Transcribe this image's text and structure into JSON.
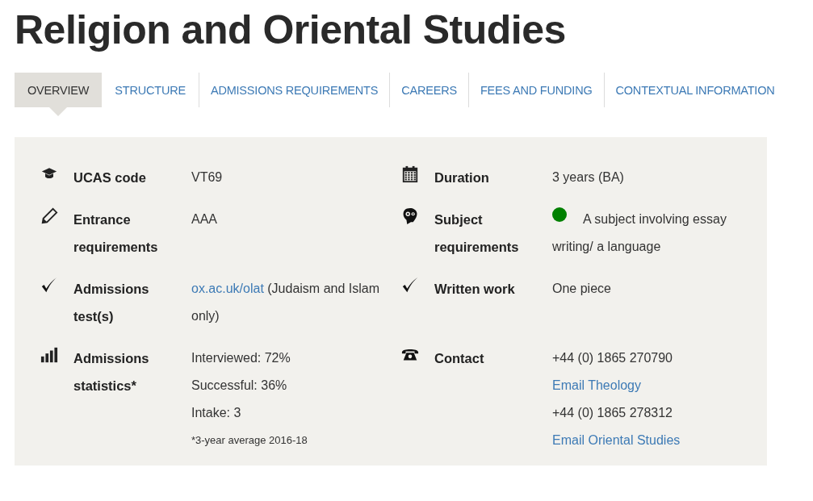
{
  "title": "Religion and Oriental Studies",
  "tabs": [
    {
      "label": "OVERVIEW",
      "selected": true
    },
    {
      "label": "STRUCTURE",
      "selected": false
    },
    {
      "label": "ADMISSIONS REQUIREMENTS",
      "selected": false
    },
    {
      "label": "CAREERS",
      "selected": false
    },
    {
      "label": "FEES AND FUNDING",
      "selected": false
    },
    {
      "label": "CONTEXTUAL INFORMATION",
      "selected": false
    }
  ],
  "facts": [
    {
      "label": "UCAS code",
      "lines": [
        [
          {
            "kind": "text",
            "text": "VT69"
          }
        ]
      ]
    },
    {
      "label": "Duration",
      "lines": [
        [
          {
            "kind": "text",
            "text": "3 years (BA)"
          }
        ]
      ]
    },
    {
      "label": "Entrance requirements",
      "lines": [
        [
          {
            "kind": "text",
            "text": "AAA"
          }
        ]
      ]
    },
    {
      "label": "Subject requirements",
      "lines": [
        [
          {
            "kind": "dot",
            "color": "#008000"
          },
          {
            "kind": "text",
            "text": "A subject involving essay writing/ a language"
          }
        ]
      ]
    },
    {
      "label": "Admissions test(s)",
      "lines": [
        [
          {
            "kind": "link",
            "text": "ox.ac.uk/olat"
          },
          {
            "kind": "text",
            "text": " (Judaism and Islam only)"
          }
        ]
      ]
    },
    {
      "label": "Written work",
      "lines": [
        [
          {
            "kind": "text",
            "text": "One piece"
          }
        ]
      ]
    },
    {
      "label": "Admissions statistics*",
      "lines": [
        [
          {
            "kind": "text",
            "text": "Interviewed: 72%"
          }
        ],
        [
          {
            "kind": "text",
            "text": "Successful: 36%"
          }
        ],
        [
          {
            "kind": "text",
            "text": "Intake: 3"
          }
        ],
        [
          {
            "kind": "note",
            "text": "*3-year average 2016-18"
          }
        ]
      ]
    },
    {
      "label": "Contact",
      "lines": [
        [
          {
            "kind": "text",
            "text": "+44 (0) 1865 270790"
          }
        ],
        [
          {
            "kind": "link",
            "text": "Email Theology"
          }
        ],
        [
          {
            "kind": "text",
            "text": "+44 (0) 1865 278312"
          }
        ],
        [
          {
            "kind": "link",
            "text": "Email Oriental Studies"
          }
        ]
      ]
    }
  ]
}
